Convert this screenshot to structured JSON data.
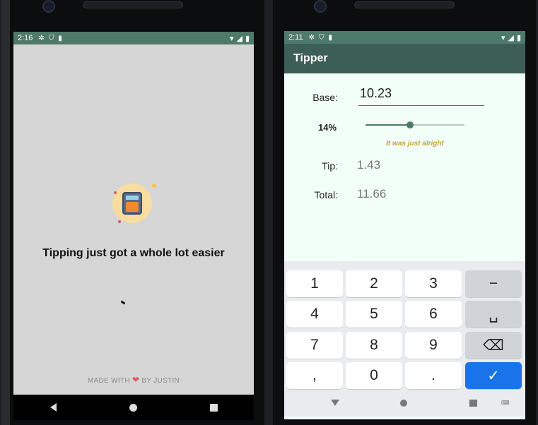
{
  "left_phone": {
    "status": {
      "time": "2:16"
    },
    "splash": {
      "title": "Tipping just got a whole lot easier",
      "footer_before": "MADE WITH",
      "footer_after": "BY JUSTIN"
    }
  },
  "right_phone": {
    "status": {
      "time": "2:11"
    },
    "app_title": "Tipper",
    "base": {
      "label": "Base:",
      "value": "10.23"
    },
    "tip_percent": {
      "label": "14%",
      "value_fraction": 0.45
    },
    "review": "It was just alright",
    "tip": {
      "label": "Tip:",
      "value": "1.43"
    },
    "total": {
      "label": "Total:",
      "value": "11.66"
    },
    "keyboard": {
      "rows": [
        [
          "1",
          "2",
          "3",
          "−"
        ],
        [
          "4",
          "5",
          "6",
          "␣"
        ],
        [
          "7",
          "8",
          "9",
          "⌫"
        ],
        [
          ",",
          "0",
          ".",
          "✓"
        ]
      ]
    }
  },
  "colors": {
    "status_bar": "#4e7a6a",
    "app_bar": "#3d5e56",
    "review_text": "#c8a332",
    "enter_key": "#1a73e8"
  }
}
